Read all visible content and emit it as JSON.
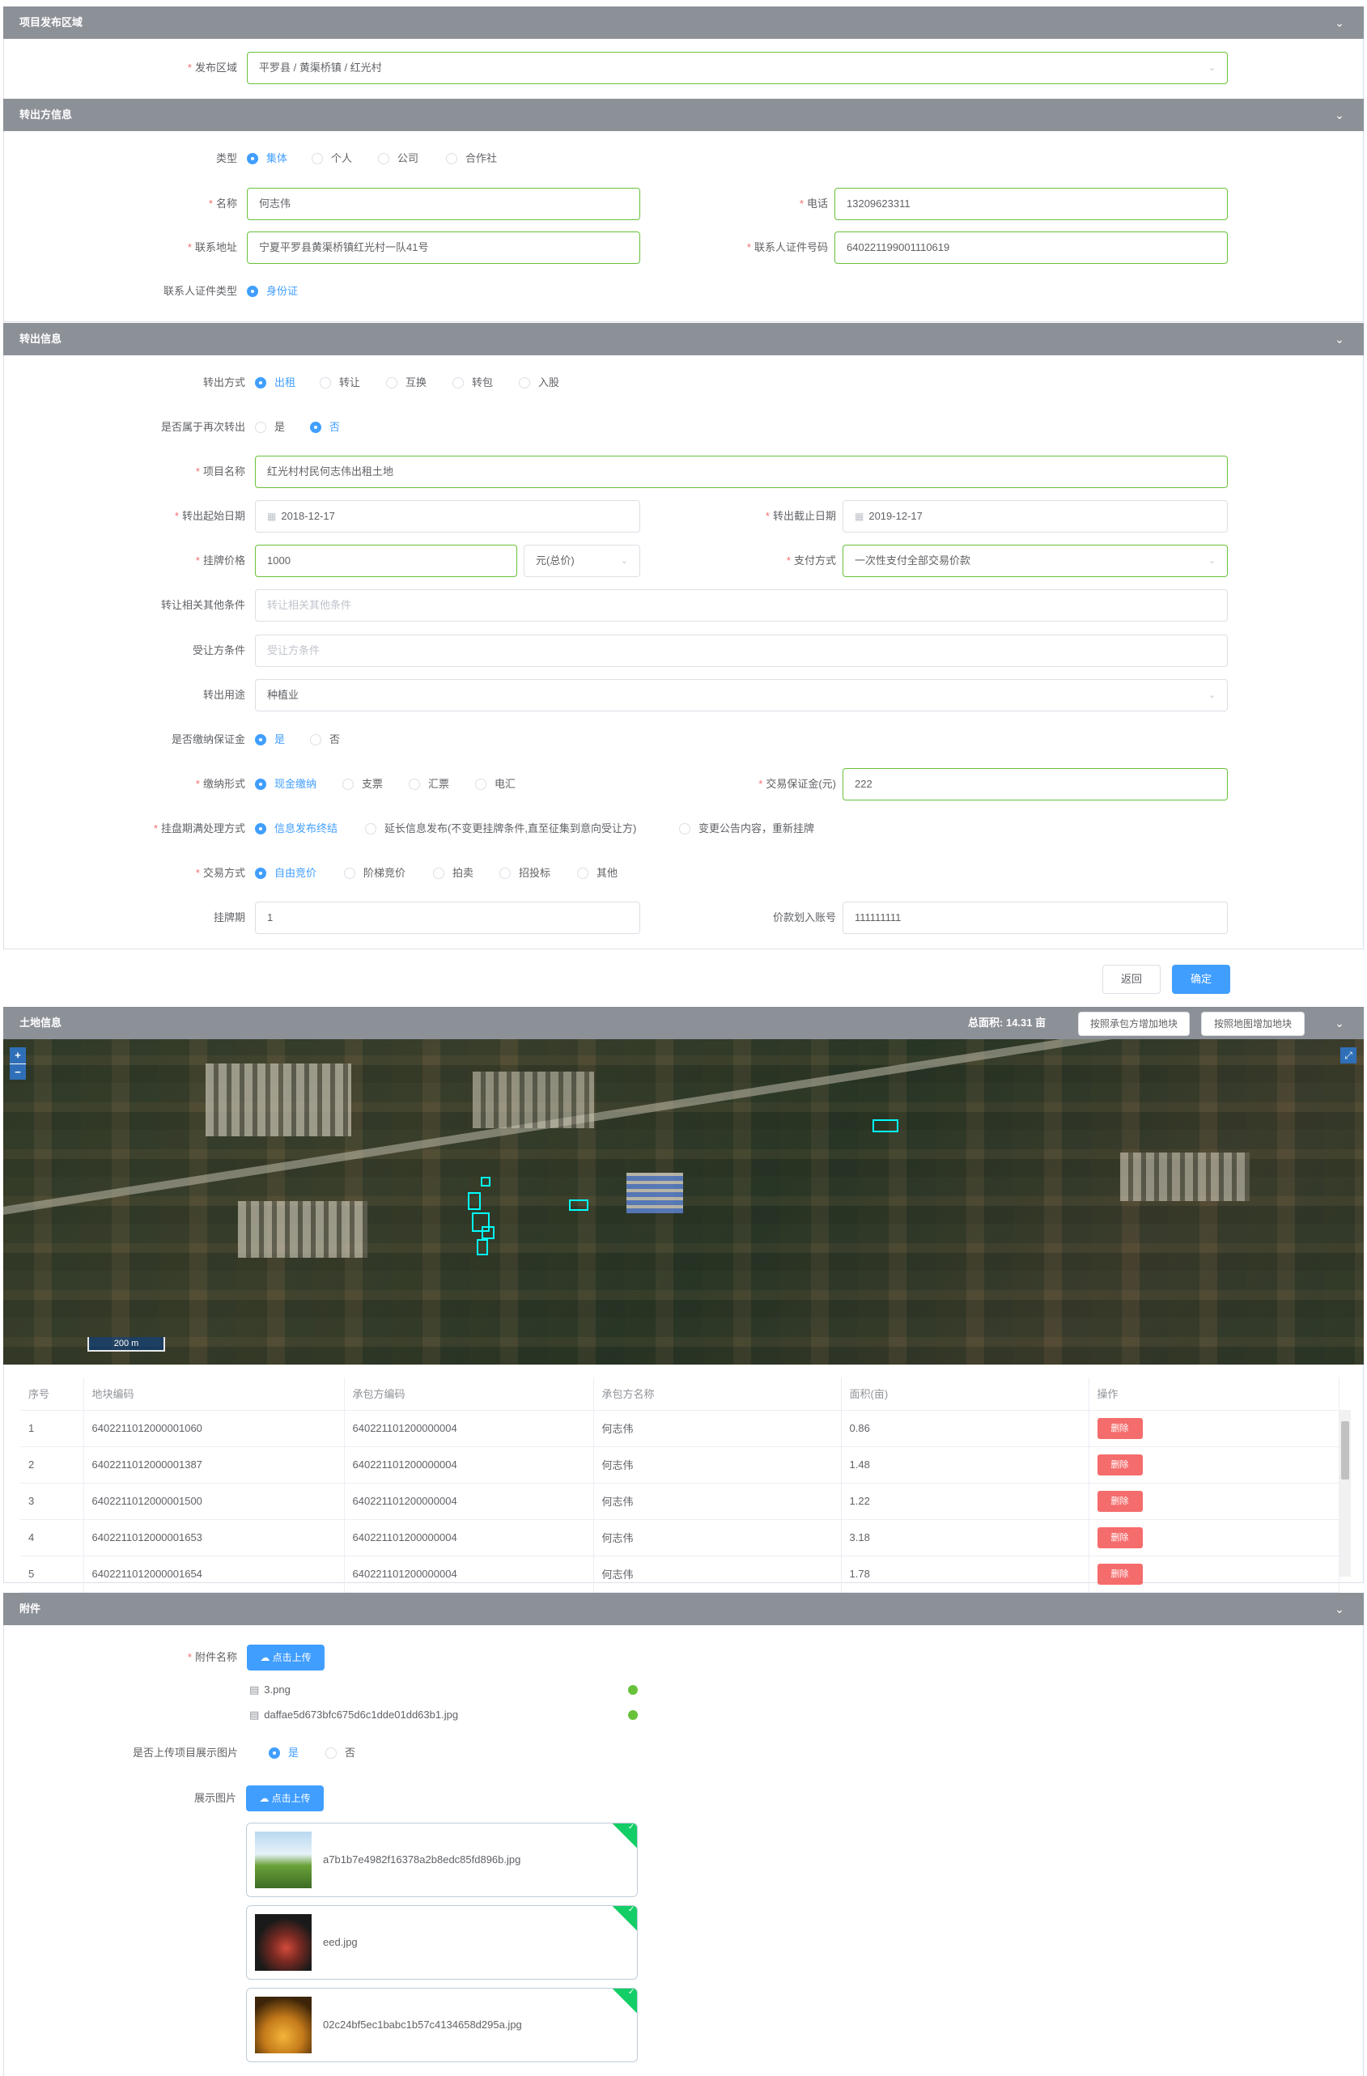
{
  "sections": {
    "publish_area": "项目发布区域",
    "transferor": "转出方信息",
    "transfer": "转出信息",
    "land": "土地信息",
    "attachments": "附件"
  },
  "publish": {
    "label": "发布区域",
    "value": "平罗县 / 黄渠桥镇 / 红光村"
  },
  "transferor": {
    "type_label": "类型",
    "type_options": [
      "集体",
      "个人",
      "公司",
      "合作社"
    ],
    "name_label": "名称",
    "name_value": "何志伟",
    "phone_label": "电话",
    "phone_value": "13209623311",
    "address_label": "联系地址",
    "address_value": "宁夏平罗县黄渠桥镇红光村一队41号",
    "id_label": "联系人证件号码",
    "id_value": "640221199001110619",
    "id_type_label": "联系人证件类型",
    "id_type_option": "身份证"
  },
  "transfer": {
    "method_label": "转出方式",
    "method_options": [
      "出租",
      "转让",
      "互换",
      "转包",
      "入股"
    ],
    "again_label": "是否属于再次转出",
    "again_yes": "是",
    "again_no": "否",
    "project_label": "项目名称",
    "project_value": "红光村村民何志伟出租土地",
    "start_label": "转出起始日期",
    "start_value": "2018-12-17",
    "end_label": "转出截止日期",
    "end_value": "2019-12-17",
    "price_label": "挂牌价格",
    "price_value": "1000",
    "price_unit": "元(总价)",
    "pay_label": "支付方式",
    "pay_value": "一次性支付全部交易价款",
    "other_label": "转让相关其他条件",
    "other_placeholder": "转让相关其他条件",
    "receiver_label": "受让方条件",
    "receiver_placeholder": "受让方条件",
    "use_label": "转出用途",
    "use_value": "种植业",
    "deposit_label": "是否缴纳保证金",
    "deposit_yes": "是",
    "deposit_no": "否",
    "form_label": "缴纳形式",
    "form_options": [
      "现金缴纳",
      "支票",
      "汇票",
      "电汇"
    ],
    "deposit_amt_label": "交易保证金(元)",
    "deposit_amt_value": "222",
    "expire_label": "挂盘期满处理方式",
    "expire_options": [
      "信息发布终结",
      "延长信息发布(不变更挂牌条件,直至征集到意向受让方)",
      "变更公告内容，重新挂牌"
    ],
    "trade_label": "交易方式",
    "trade_options": [
      "自由竞价",
      "阶梯竞价",
      "拍卖",
      "招投标",
      "其他"
    ],
    "period_label": "挂牌期",
    "period_value": "1",
    "account_label": "价款划入账号",
    "account_value": "111111111"
  },
  "actions": {
    "back": "返回",
    "confirm": "确定"
  },
  "land": {
    "total_label": "总面积:",
    "total_value": "14.31 亩",
    "btn_by_contractor": "按照承包方增加地块",
    "btn_by_map": "按照地图增加地块",
    "scale": "200 m",
    "zoom_in": "+",
    "zoom_out": "−",
    "fullscreen": "⤢",
    "columns": [
      "序号",
      "地块编码",
      "承包方编码",
      "承包方名称",
      "面积(亩)",
      "操作"
    ],
    "delete_label": "删除",
    "rows": [
      [
        "1",
        "6402211012000001060",
        "640221101200000004",
        "何志伟",
        "0.86"
      ],
      [
        "2",
        "6402211012000001387",
        "640221101200000004",
        "何志伟",
        "1.48"
      ],
      [
        "3",
        "6402211012000001500",
        "640221101200000004",
        "何志伟",
        "1.22"
      ],
      [
        "4",
        "6402211012000001653",
        "640221101200000004",
        "何志伟",
        "3.18"
      ],
      [
        "5",
        "6402211012000001654",
        "640221101200000004",
        "何志伟",
        "1.78"
      ]
    ]
  },
  "attach": {
    "name_label": "附件名称",
    "upload": "点击上传",
    "files": [
      "3.png",
      "daffae5d673bfc675d6c1dde01dd63b1.jpg"
    ],
    "show_label": "是否上传项目展示图片",
    "show_yes": "是",
    "show_no": "否",
    "pics_label": "展示图片",
    "pics": [
      "a7b1b7e4982f16378a2b8edc85fd896b.jpg",
      "eed.jpg",
      "02c24bf5ec1babc1b57c4134658d295a.jpg"
    ]
  },
  "colors": {
    "primary": "#409eff",
    "success": "#67c23a",
    "danger": "#f56c6c",
    "header": "#8c9097",
    "field": "#00ffff"
  }
}
